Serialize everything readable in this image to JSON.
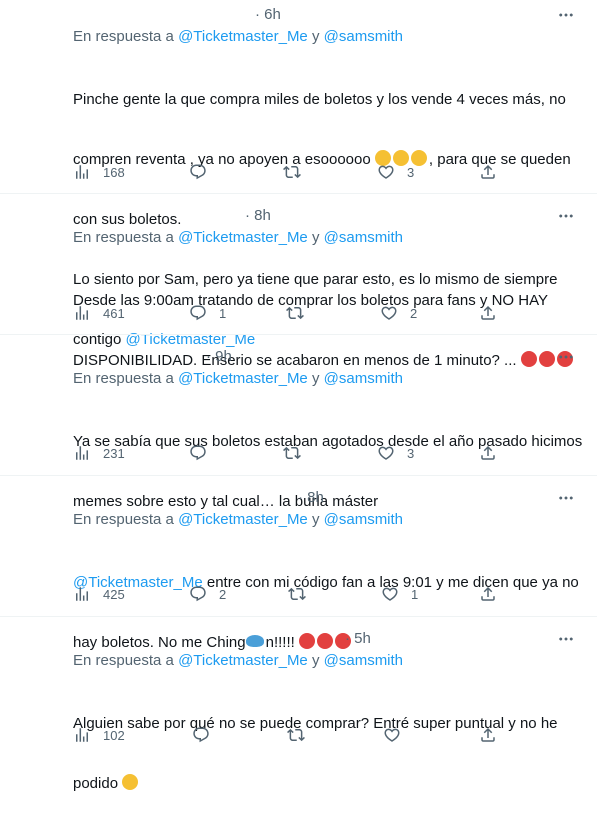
{
  "tweets": [
    {
      "time": "· 6h",
      "reply_prefix": "En respuesta a",
      "reply_user1": "@Ticketmaster_Me",
      "reply_and": "y",
      "reply_user2": "@samsmith",
      "line1": "Pinche gente la que compra miles de boletos y los vende 4 veces más, no",
      "line2a": "compren reventa , ya no apoyen a esoooooo",
      "line2b": ", para que se queden",
      "line3": "con sus boletos.",
      "line4": "Lo siento por Sam, pero ya tiene que parar esto, es lo mismo de siempre",
      "line5a": "contigo",
      "line5_mention": "@Ticketmaster_Me",
      "views": "168",
      "replies": "",
      "retweets": "",
      "likes": "3"
    },
    {
      "time": "· 8h",
      "reply_prefix": "En respuesta a",
      "reply_user1": "@Ticketmaster_Me",
      "reply_and": "y",
      "reply_user2": "@samsmith",
      "line1": "Desde las 9:00am tratando de comprar los boletos para fans y NO HAY",
      "line2a": "DISPONIBILIDAD. Enserio se acabaron en menos de 1 minuto? ...",
      "views": "461",
      "replies": "1",
      "retweets": "",
      "likes": "2"
    },
    {
      "time": "· 9h",
      "reply_prefix": "En respuesta a",
      "reply_user1": "@Ticketmaster_Me",
      "reply_and": "y",
      "reply_user2": "@samsmith",
      "line1": "Ya se sabía que sus boletos estaban agotados desde el año pasado hicimos",
      "line2a": "memes sobre esto y tal cual… la burla máster",
      "views": "231",
      "replies": "",
      "retweets": "",
      "likes": "3"
    },
    {
      "time": "· 8h",
      "reply_prefix": "En respuesta a",
      "reply_user1": "@Ticketmaster_Me",
      "reply_and": "y",
      "reply_user2": "@samsmith",
      "line1_mention": "@Ticketmaster_Me",
      "line1": " entre con mi código fan a las 9:01 y me dicen que ya no",
      "line2a": "hay boletos. No me Ching",
      "line2b": "n!!!!!",
      "views": "425",
      "replies": "2",
      "retweets": "",
      "likes": "1"
    },
    {
      "time": "· 5h",
      "reply_prefix": "En respuesta a",
      "reply_user1": "@Ticketmaster_Me",
      "reply_and": "y",
      "reply_user2": "@samsmith",
      "line1": "Alguien sabe por qué no se puede comprar? Entré super puntual y no he",
      "line2a": "podido",
      "views": "102",
      "replies": "",
      "retweets": "",
      "likes": ""
    }
  ],
  "icons": {
    "views": "analytics-bar-icon",
    "reply": "reply-bubble-icon",
    "retweet": "retweet-icon",
    "like": "heart-icon",
    "share": "share-upload-icon",
    "more": "more-dots-icon"
  },
  "colors": {
    "link": "#1d9bf0",
    "secondary_text": "#536471",
    "divider": "#eff3f4"
  }
}
